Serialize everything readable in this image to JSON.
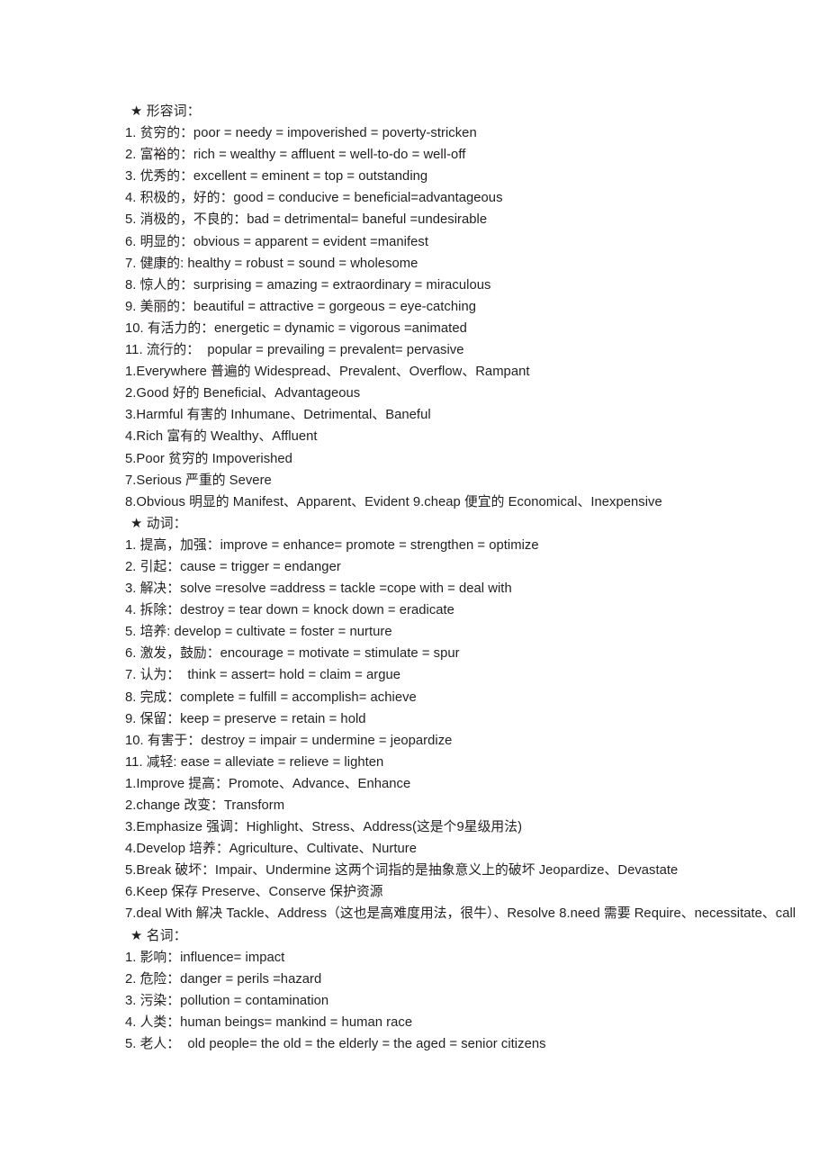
{
  "document": {
    "kind": "vocabulary-synonym-study-sheet",
    "background_color": "#ffffff",
    "text_color": "#231f20",
    "sections": [
      {
        "heading": "★ 形容词：",
        "heading_icon": "star-icon",
        "lines": [
          "1. 贫穷的：poor = needy = impoverished = poverty-stricken",
          "2. 富裕的：rich = wealthy = affluent = well-to-do = well-off",
          "3. 优秀的：excellent = eminent = top = outstanding",
          "4. 积极的，好的：good = conducive = beneficial=advantageous",
          "5. 消极的，不良的：bad = detrimental= baneful =undesirable",
          "6. 明显的：obvious = apparent = evident =manifest",
          "7. 健康的: healthy = robust = sound = wholesome",
          "8. 惊人的：surprising = amazing = extraordinary = miraculous",
          "9. 美丽的：beautiful = attractive = gorgeous = eye-catching",
          "10. 有活力的：energetic = dynamic = vigorous =animated",
          "11. 流行的：  popular = prevailing = prevalent= pervasive",
          "1.Everywhere 普遍的 Widespread、Prevalent、Overflow、Rampant",
          "2.Good 好的 Beneficial、Advantageous",
          "3.Harmful 有害的 Inhumane、Detrimental、Baneful",
          "4.Rich 富有的 Wealthy、Affluent",
          "5.Poor 贫穷的 Impoverished",
          "7.Serious 严重的 Severe",
          "8.Obvious 明显的 Manifest、Apparent、Evident 9.cheap 便宜的 Economical、Inexpensive"
        ]
      },
      {
        "heading": "★ 动词：",
        "heading_icon": "star-icon",
        "lines": [
          "1. 提高，加强：improve = enhance= promote = strengthen = optimize",
          "2. 引起：cause = trigger = endanger",
          "3. 解决：solve =resolve =address = tackle =cope with = deal with",
          "4. 拆除：destroy = tear down = knock down = eradicate",
          "5. 培养: develop = cultivate = foster = nurture",
          "6. 激发，鼓励：encourage = motivate = stimulate = spur",
          "7. 认为：  think = assert= hold = claim = argue",
          "8. 完成：complete = fulfill = accomplish= achieve",
          "9. 保留：keep = preserve = retain = hold",
          "10. 有害于：destroy = impair = undermine = jeopardize",
          "11. 减轻: ease = alleviate = relieve = lighten",
          "1.Improve 提高：Promote、Advance、Enhance",
          "2.change 改变：Transform",
          "3.Emphasize 强调：Highlight、Stress、Address(这是个9星级用法)",
          "4.Develop 培养：Agriculture、Cultivate、Nurture",
          "5.Break 破坏：Impair、Undermine 这两个词指的是抽象意义上的破坏 Jeopardize、Devastate",
          "6.Keep 保存 Preserve、Conserve 保护资源",
          "7.deal With 解决 Tackle、Address（这也是高难度用法，很牛）、Resolve 8.need 需要 Require、necessitate、call"
        ]
      },
      {
        "heading": "★ 名词：",
        "heading_icon": "star-icon",
        "lines": [
          "1. 影响：influence= impact",
          "2. 危险：danger = perils =hazard",
          "3. 污染：pollution = contamination",
          "4. 人类：human beings= mankind = human race",
          "5. 老人：  old people= the old = the elderly = the aged = senior citizens"
        ]
      }
    ]
  }
}
